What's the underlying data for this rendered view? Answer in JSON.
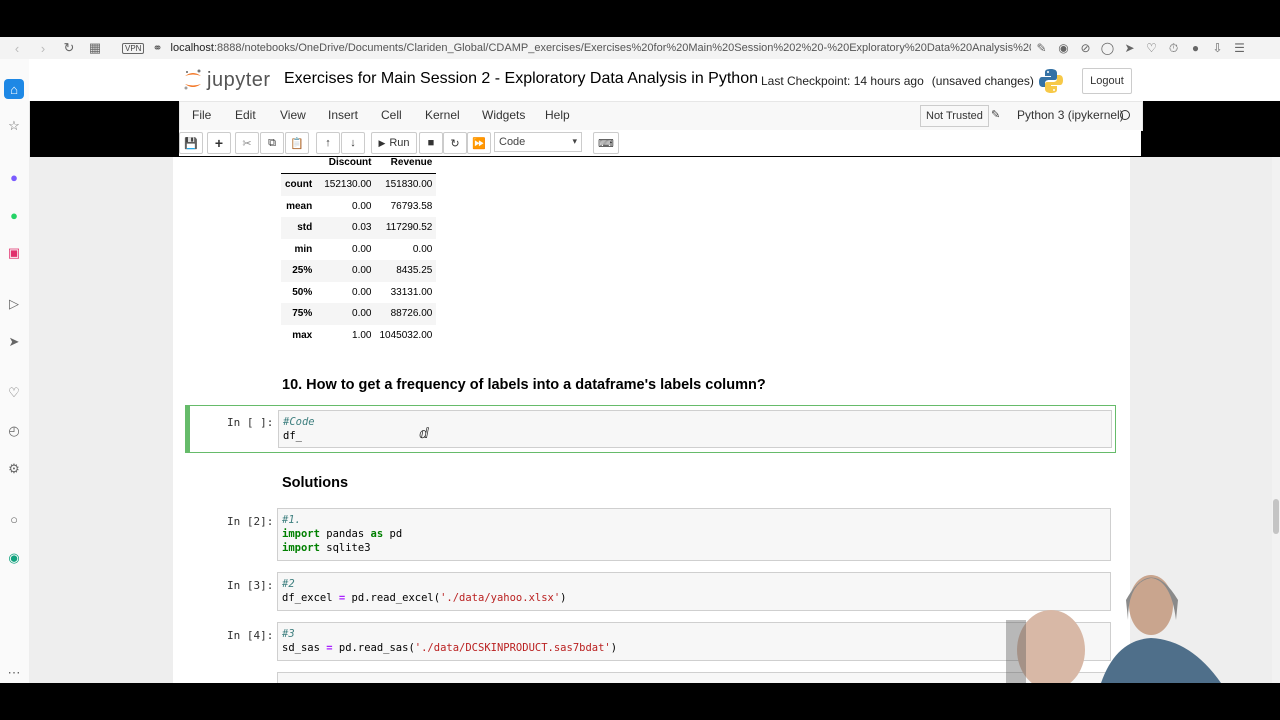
{
  "browser": {
    "url_host": "localhost",
    "url_path": ":8888/notebooks/OneDrive/Documents/Clariden_Global/CDAMP_exercises/Exercises%20for%20Main%20Session%202%20-%20Exploratory%20Data%20Analysis%20in%20Python",
    "vpn_label": "VPN"
  },
  "header": {
    "logo_text": "jupyter",
    "notebook_title": "Exercises for Main Session 2 - Exploratory Data Analysis in Python",
    "checkpoint": "Last Checkpoint: 14 hours ago",
    "unsaved": "(unsaved changes)",
    "logout_label": "Logout"
  },
  "menu": {
    "items": [
      "File",
      "Edit",
      "View",
      "Insert",
      "Cell",
      "Kernel",
      "Widgets",
      "Help"
    ],
    "trust_label": "Not Trusted",
    "kernel_label": "Python 3 (ipykernel)"
  },
  "toolbar": {
    "run_label": "Run",
    "cell_type": "Code"
  },
  "describe_table": {
    "columns": [
      "Discount",
      "Revenue"
    ],
    "rows": [
      {
        "label": "count",
        "discount": "152130.00",
        "revenue": "151830.00"
      },
      {
        "label": "mean",
        "discount": "0.00",
        "revenue": "76793.58"
      },
      {
        "label": "std",
        "discount": "0.03",
        "revenue": "117290.52"
      },
      {
        "label": "min",
        "discount": "0.00",
        "revenue": "0.00"
      },
      {
        "label": "25%",
        "discount": "0.00",
        "revenue": "8435.25"
      },
      {
        "label": "50%",
        "discount": "0.00",
        "revenue": "33131.00"
      },
      {
        "label": "75%",
        "discount": "0.00",
        "revenue": "88726.00"
      },
      {
        "label": "max",
        "discount": "1.00",
        "revenue": "1045032.00"
      }
    ]
  },
  "question": {
    "heading": "10. How to get a frequency of labels into a dataframe's labels column?"
  },
  "active_cell": {
    "prompt": "In [ ]:",
    "line1": "#Code",
    "line2": "df_"
  },
  "solutions": {
    "heading": "Solutions",
    "cells": [
      {
        "prompt": "In [2]:",
        "comment": "#1.",
        "l2_kw": "import",
        "l2_rest": " pandas ",
        "l2_as": "as",
        "l2_alias": " pd",
        "l3_kw": "import",
        "l3_rest": " sqlite3"
      },
      {
        "prompt": "In [3]:",
        "comment": "#2",
        "code_pre": "df_excel ",
        "code_eq": "=",
        "code_mid": " pd.read_excel(",
        "code_str": "'./data/yahoo.xlsx'",
        "code_post": ")"
      },
      {
        "prompt": "In [4]:",
        "comment": "#3",
        "code_pre": "sd_sas ",
        "code_eq": "=",
        "code_mid": " pd.read_sas(",
        "code_str": "'./data/DCSKINPRODUCT.sas7bdat'",
        "code_post": ")"
      }
    ]
  }
}
